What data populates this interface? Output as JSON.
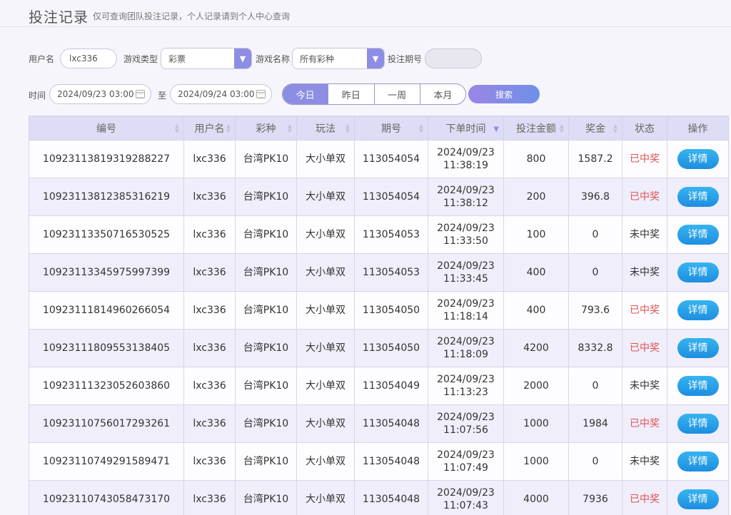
{
  "header": {
    "title": "投注记录",
    "subtitle": "仅可查询团队投注记录，个人记录请到个人中心查询"
  },
  "filters": {
    "username_label": "用户名",
    "username_value": "lxc336",
    "game_type_label": "游戏类型",
    "game_type_value": "彩票",
    "game_name_label": "游戏名称",
    "game_name_value": "所有彩种",
    "period_label": "投注期号",
    "period_value": "",
    "time_label": "时间",
    "start_time": "2024/09/23 03:00",
    "to_label": "至",
    "end_time": "2024/09/24 03:00",
    "quick_ranges": [
      "今日",
      "昨日",
      "一周",
      "本月"
    ],
    "active_range": "今日",
    "search_label": "搜索"
  },
  "table": {
    "columns": [
      "编号",
      "用户名",
      "彩种",
      "玩法",
      "期号",
      "下单时间",
      "投注金额",
      "奖金",
      "状态",
      "操作"
    ],
    "detail_label": "详情",
    "rows": [
      {
        "id": "10923113819319288227",
        "user": "lxc336",
        "lottery": "台湾PK10",
        "play": "大小单双",
        "period": "113054054",
        "date": "2024/09/23",
        "time": "11:38:19",
        "amount": "800",
        "prize": "1587.2",
        "status": "已中奖",
        "won": true
      },
      {
        "id": "10923113812385316219",
        "user": "lxc336",
        "lottery": "台湾PK10",
        "play": "大小单双",
        "period": "113054054",
        "date": "2024/09/23",
        "time": "11:38:12",
        "amount": "200",
        "prize": "396.8",
        "status": "已中奖",
        "won": true
      },
      {
        "id": "10923113350716530525",
        "user": "lxc336",
        "lottery": "台湾PK10",
        "play": "大小单双",
        "period": "113054053",
        "date": "2024/09/23",
        "time": "11:33:50",
        "amount": "100",
        "prize": "0",
        "status": "未中奖",
        "won": false
      },
      {
        "id": "10923113345975997399",
        "user": "lxc336",
        "lottery": "台湾PK10",
        "play": "大小单双",
        "period": "113054053",
        "date": "2024/09/23",
        "time": "11:33:45",
        "amount": "400",
        "prize": "0",
        "status": "未中奖",
        "won": false
      },
      {
        "id": "10923111814960266054",
        "user": "lxc336",
        "lottery": "台湾PK10",
        "play": "大小单双",
        "period": "113054050",
        "date": "2024/09/23",
        "time": "11:18:14",
        "amount": "400",
        "prize": "793.6",
        "status": "已中奖",
        "won": true
      },
      {
        "id": "10923111809553138405",
        "user": "lxc336",
        "lottery": "台湾PK10",
        "play": "大小单双",
        "period": "113054050",
        "date": "2024/09/23",
        "time": "11:18:09",
        "amount": "4200",
        "prize": "8332.8",
        "status": "已中奖",
        "won": true
      },
      {
        "id": "10923111323052603860",
        "user": "lxc336",
        "lottery": "台湾PK10",
        "play": "大小单双",
        "period": "113054049",
        "date": "2024/09/23",
        "time": "11:13:23",
        "amount": "2000",
        "prize": "0",
        "status": "未中奖",
        "won": false
      },
      {
        "id": "10923110756017293261",
        "user": "lxc336",
        "lottery": "台湾PK10",
        "play": "大小单双",
        "period": "113054048",
        "date": "2024/09/23",
        "time": "11:07:56",
        "amount": "1000",
        "prize": "1984",
        "status": "已中奖",
        "won": true
      },
      {
        "id": "10923110749291589471",
        "user": "lxc336",
        "lottery": "台湾PK10",
        "play": "大小单双",
        "period": "113054048",
        "date": "2024/09/23",
        "time": "11:07:49",
        "amount": "1000",
        "prize": "0",
        "status": "未中奖",
        "won": false
      },
      {
        "id": "10923110743058473170",
        "user": "lxc336",
        "lottery": "台湾PK10",
        "play": "大小单双",
        "period": "113054048",
        "date": "2024/09/23",
        "time": "11:07:43",
        "amount": "4000",
        "prize": "7936",
        "status": "已中奖",
        "won": true
      }
    ]
  },
  "colors": {
    "accent": "#8d8ee3",
    "win": "#e05252",
    "detail_button": "#1e8ee0"
  }
}
